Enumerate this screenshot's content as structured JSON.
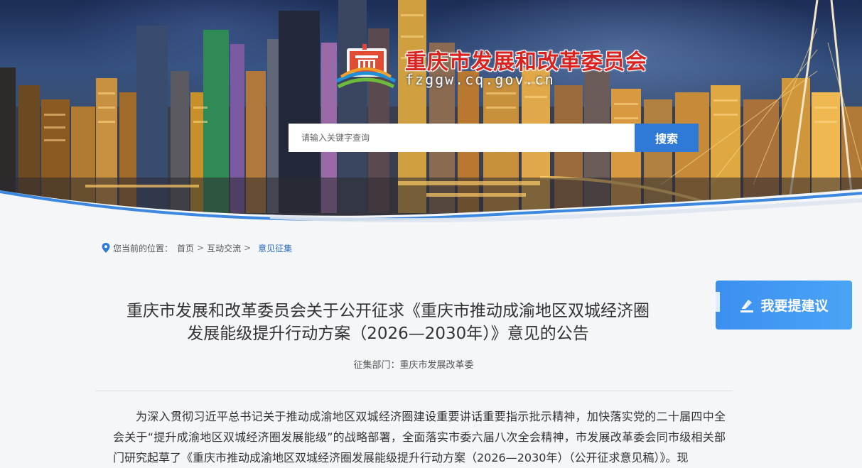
{
  "header": {
    "site_title": "重庆市发展和改革委员会",
    "site_domain": "fzggw.cq.gov.cn",
    "search": {
      "placeholder": "请输入关键字查询",
      "button_label": "搜索"
    }
  },
  "breadcrumb": {
    "prefix": "您当前的位置：",
    "items": [
      "首页",
      "互动交流"
    ],
    "separator": ">",
    "current": "意见征集"
  },
  "side_action": {
    "label": "我要提建议"
  },
  "article": {
    "title_line1": "重庆市发展和改革委员会关于公开征求《重庆市推动成渝地区双城经济圈",
    "title_line2": "发展能级提升行动方案（2026—2030年）》意见的公告",
    "department_label": "征集部门：",
    "department": "重庆市发展改革委",
    "body": "为深入贯彻习近平总书记关于推动成渝地区双城经济圈建设重要讲话重要指示批示精神，加快落实党的二十届四中全会关于“提升成渝地区双城经济圈发展能级”的战略部署，全面落实市委六届八次全会精神，市发展改革委会同市级相关部门研究起草了《重庆市推动成渝地区双城经济圈发展能级提升行动方案（2026—2030年）（公开征求意见稿）》。现"
  },
  "icons": {
    "logo": "cqfgw-emblem-icon",
    "location": "location-pin-icon",
    "suggest": "pen-edit-icon"
  },
  "colors": {
    "brand_red": "#d8231f",
    "accent_blue": "#2f7ad6",
    "suggest_blue": "#3b8ff0",
    "breadcrumb_current": "#2f6fc2"
  }
}
